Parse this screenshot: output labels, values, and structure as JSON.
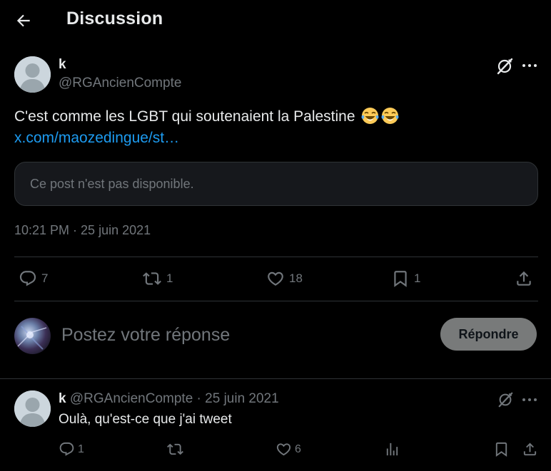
{
  "header": {
    "title": "Discussion"
  },
  "main_tweet": {
    "author_name": "k",
    "handle": "@RGAncienCompte",
    "text": "C'est comme les LGBT qui soutenaient la Palestine",
    "emoji": [
      "face-with-tears-of-joy",
      "face-with-tears-of-joy"
    ],
    "link_text": "x.com/maozedingue/st…",
    "quote_unavailable": "Ce post n'est pas disponible.",
    "timestamp": "10:21 PM · 25 juin 2021",
    "stats": {
      "replies": "7",
      "retweets": "1",
      "likes": "18",
      "bookmarks": "1"
    }
  },
  "compose": {
    "placeholder": "Postez votre réponse",
    "button_label": "Répondre"
  },
  "reply": {
    "author_name": "k",
    "handle_and_date": "@RGAncienCompte · 25 juin 2021",
    "text": "Oulà, qu'est-ce que j'ai tweet",
    "stats": {
      "replies": "1",
      "retweets": "",
      "likes": "6",
      "views": ""
    }
  },
  "colors": {
    "background": "#000000",
    "primary_text": "#e7e9ea",
    "secondary_text": "#71767b",
    "link": "#1d9bf0",
    "divider": "#2f3336",
    "reply_button_bg": "#787a7a"
  }
}
